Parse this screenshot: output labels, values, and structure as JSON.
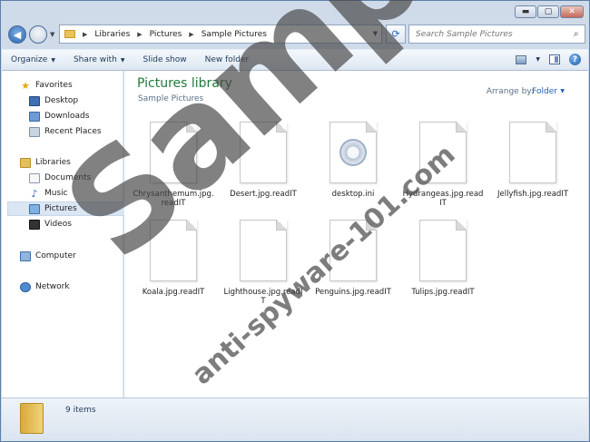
{
  "window": {
    "caption_buttons": {
      "minimize": "▬",
      "maximize": "▢",
      "close": "✕"
    }
  },
  "address_bar": {
    "breadcrumbs": [
      "Libraries",
      "Pictures",
      "Sample Pictures"
    ]
  },
  "search": {
    "placeholder": "Search Sample Pictures"
  },
  "toolbar": {
    "organize": "Organize",
    "share_with": "Share with",
    "slide_show": "Slide show",
    "new_folder": "New folder"
  },
  "sidebar": {
    "favorites": {
      "label": "Favorites",
      "items": [
        "Desktop",
        "Downloads",
        "Recent Places"
      ]
    },
    "libraries": {
      "label": "Libraries",
      "items": [
        "Documents",
        "Music",
        "Pictures",
        "Videos"
      ],
      "selected": "Pictures"
    },
    "computer": "Computer",
    "network": "Network"
  },
  "library": {
    "title": "Pictures library",
    "subtitle": "Sample Pictures",
    "arrange_label": "Arrange by:",
    "arrange_value": "Folder"
  },
  "files": [
    {
      "name": "Chrysanthemum.jpg.readIT",
      "icon": "blank-file-icon"
    },
    {
      "name": "Desert.jpg.readIT",
      "icon": "blank-file-icon"
    },
    {
      "name": "desktop.ini",
      "icon": "settings-file-icon"
    },
    {
      "name": "Hydrangeas.jpg.readIT",
      "icon": "blank-file-icon"
    },
    {
      "name": "Jellyfish.jpg.readIT",
      "icon": "blank-file-icon"
    },
    {
      "name": "Koala.jpg.readIT",
      "icon": "blank-file-icon"
    },
    {
      "name": "Lighthouse.jpg.readIT",
      "icon": "blank-file-icon"
    },
    {
      "name": "Penguins.jpg.readIT",
      "icon": "blank-file-icon"
    },
    {
      "name": "Tulips.jpg.readIT",
      "icon": "blank-file-icon"
    }
  ],
  "status": {
    "count": "9 items"
  },
  "watermark": {
    "main": "Sample",
    "site": "anti-spyware-101.com"
  }
}
